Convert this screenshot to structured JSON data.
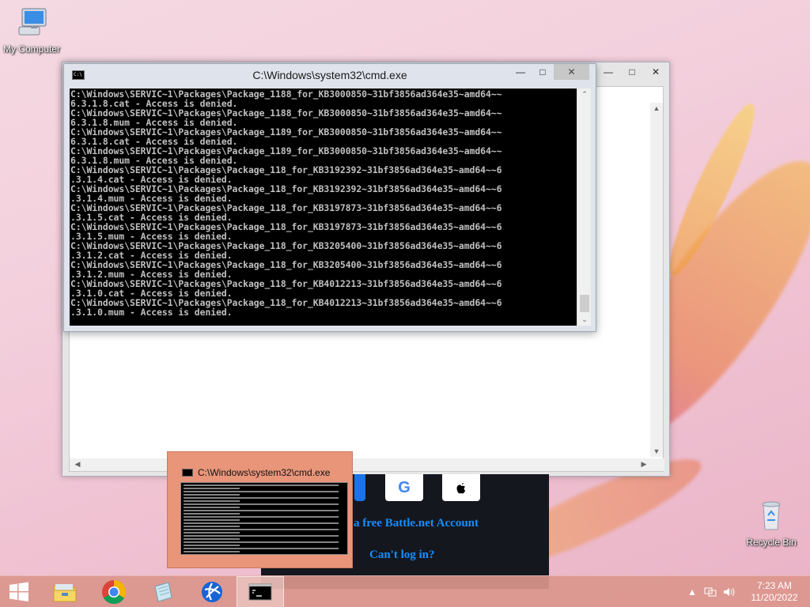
{
  "desktop": {
    "icons": [
      {
        "label": "My Computer",
        "icon": "computer-icon"
      },
      {
        "label": "Recycle Bin",
        "icon": "recycle-bin-icon"
      }
    ]
  },
  "cmd_window": {
    "title": "C:\\Windows\\system32\\cmd.exe",
    "icon": "cmd-icon",
    "lines": [
      "C:\\Windows\\SERVIC~1\\Packages\\Package_1188_for_KB3000850~31bf3856ad364e35~amd64~~",
      "6.3.1.8.cat - Access is denied.",
      "C:\\Windows\\SERVIC~1\\Packages\\Package_1188_for_KB3000850~31bf3856ad364e35~amd64~~",
      "6.3.1.8.mum - Access is denied.",
      "C:\\Windows\\SERVIC~1\\Packages\\Package_1189_for_KB3000850~31bf3856ad364e35~amd64~~",
      "6.3.1.8.cat - Access is denied.",
      "C:\\Windows\\SERVIC~1\\Packages\\Package_1189_for_KB3000850~31bf3856ad364e35~amd64~~",
      "6.3.1.8.mum - Access is denied.",
      "C:\\Windows\\SERVIC~1\\Packages\\Package_118_for_KB3192392~31bf3856ad364e35~amd64~~6",
      ".3.1.4.cat - Access is denied.",
      "C:\\Windows\\SERVIC~1\\Packages\\Package_118_for_KB3192392~31bf3856ad364e35~amd64~~6",
      ".3.1.4.mum - Access is denied.",
      "C:\\Windows\\SERVIC~1\\Packages\\Package_118_for_KB3197873~31bf3856ad364e35~amd64~~6",
      ".3.1.5.cat - Access is denied.",
      "C:\\Windows\\SERVIC~1\\Packages\\Package_118_for_KB3197873~31bf3856ad364e35~amd64~~6",
      ".3.1.5.mum - Access is denied.",
      "C:\\Windows\\SERVIC~1\\Packages\\Package_118_for_KB3205400~31bf3856ad364e35~amd64~~6",
      ".3.1.2.cat - Access is denied.",
      "C:\\Windows\\SERVIC~1\\Packages\\Package_118_for_KB3205400~31bf3856ad364e35~amd64~~6",
      ".3.1.2.mum - Access is denied.",
      "C:\\Windows\\SERVIC~1\\Packages\\Package_118_for_KB4012213~31bf3856ad364e35~amd64~~6",
      ".3.1.0.cat - Access is denied.",
      "C:\\Windows\\SERVIC~1\\Packages\\Package_118_for_KB4012213~31bf3856ad364e35~amd64~~6",
      ".3.1.0.mum - Access is denied."
    ]
  },
  "battlenet": {
    "create_account_link": "a free Battle.net Account",
    "cant_login_link": "Can't log in?",
    "social_icons": [
      "google-icon",
      "apple-icon"
    ]
  },
  "thumbnail": {
    "title": "C:\\Windows\\system32\\cmd.exe"
  },
  "taskbar": {
    "items": [
      "start-button",
      "file-explorer-icon",
      "chrome-icon",
      "notepad-icon",
      "battlenet-icon",
      "cmd-icon"
    ],
    "clock_time": "7:23 AM",
    "clock_date": "11/20/2022"
  },
  "colors": {
    "taskbar": "#da968c",
    "console_bg": "#000000",
    "console_text": "#c0c0c0",
    "bnet_link": "#148eff"
  }
}
